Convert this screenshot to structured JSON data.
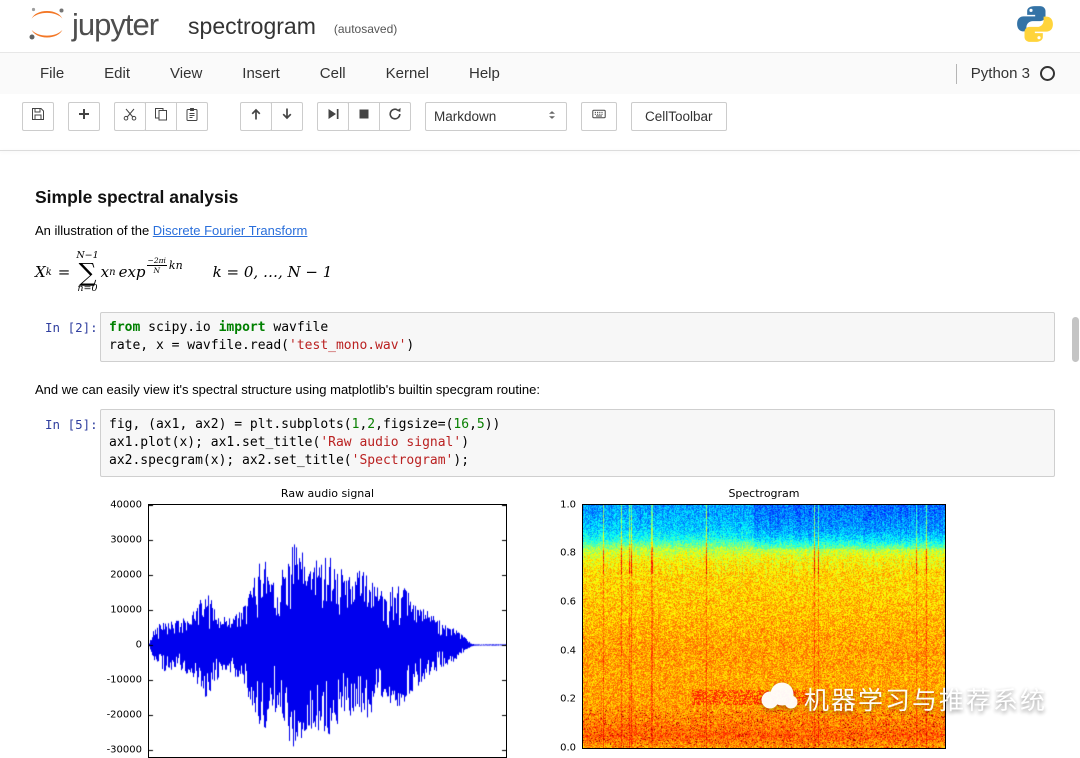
{
  "header": {
    "logo_text": "jupyter",
    "title": "spectrogram",
    "autosaved": "(autosaved)"
  },
  "menu": {
    "items": [
      "File",
      "Edit",
      "View",
      "Insert",
      "Cell",
      "Kernel",
      "Help"
    ],
    "kernel_name": "Python 3"
  },
  "toolbar": {
    "icons": [
      "save-icon",
      "add-cell-icon",
      "cut-icon",
      "copy-icon",
      "paste-icon",
      "arrow-up-icon",
      "arrow-down-icon",
      "run-icon",
      "stop-icon",
      "restart-icon",
      "keyboard-icon"
    ],
    "cell_type": "Markdown",
    "cell_toolbar_label": "CellToolbar"
  },
  "notebook": {
    "markdown_cell_1": {
      "heading": "Simple spectral analysis",
      "intro_text": "An illustration of the ",
      "link_text": "Discrete Fourier Transform",
      "formula": {
        "lhs_base": "X",
        "lhs_sub": "k",
        "equals": "=",
        "sum_upper": "N−1",
        "sum_symbol": "∑",
        "sum_lower": "n=0",
        "term_base": "x",
        "term_sub": "n",
        "func": "exp",
        "exp_numerator": "−2πi",
        "exp_denominator": "N",
        "exp_suffix": "kn",
        "condition": "k = 0, …, N − 1"
      }
    },
    "code_cell_1": {
      "prompt": "In [2]:",
      "lines": [
        [
          {
            "t": "kw",
            "v": "from"
          },
          {
            "t": "p",
            "v": " scipy.io "
          },
          {
            "t": "kw",
            "v": "import"
          },
          {
            "t": "p",
            "v": " wavfile"
          }
        ],
        [
          {
            "t": "p",
            "v": "rate, x = wavfile.read("
          },
          {
            "t": "s",
            "v": "'test_mono.wav'"
          },
          {
            "t": "p",
            "v": ")"
          }
        ]
      ]
    },
    "markdown_cell_2": {
      "text": "And we can easily view it's spectral structure using matplotlib's builtin specgram routine:"
    },
    "code_cell_2": {
      "prompt": "In [5]:",
      "lines": [
        [
          {
            "t": "p",
            "v": "fig, (ax1, ax2) = plt.subplots("
          },
          {
            "t": "n",
            "v": "1"
          },
          {
            "t": "p",
            "v": ","
          },
          {
            "t": "n",
            "v": "2"
          },
          {
            "t": "p",
            "v": ",figsize=("
          },
          {
            "t": "n",
            "v": "16"
          },
          {
            "t": "p",
            "v": ","
          },
          {
            "t": "n",
            "v": "5"
          },
          {
            "t": "p",
            "v": "))"
          }
        ],
        [
          {
            "t": "p",
            "v": "ax1.plot(x); ax1.set_title("
          },
          {
            "t": "s",
            "v": "'Raw audio signal'"
          },
          {
            "t": "p",
            "v": ")"
          }
        ],
        [
          {
            "t": "p",
            "v": "ax2.specgram(x); ax2.set_title("
          },
          {
            "t": "s",
            "v": "'Spectrogram'"
          },
          {
            "t": "p",
            "v": ");"
          }
        ]
      ]
    }
  },
  "chart_data": [
    {
      "type": "line",
      "title": "Raw audio signal",
      "ylim": [
        -32000,
        40000
      ],
      "yticks": [
        "40000",
        "30000",
        "20000",
        "10000",
        "0",
        "-10000",
        "-20000",
        "-30000"
      ],
      "line_color": "#0000ee",
      "amplitude_envelope": [
        [
          0,
          500
        ],
        [
          0.01,
          4000
        ],
        [
          0.04,
          8000
        ],
        [
          0.08,
          7000
        ],
        [
          0.12,
          9000
        ],
        [
          0.16,
          16000
        ],
        [
          0.2,
          8000
        ],
        [
          0.26,
          10000
        ],
        [
          0.32,
          27000
        ],
        [
          0.36,
          18000
        ],
        [
          0.4,
          30000
        ],
        [
          0.45,
          24000
        ],
        [
          0.5,
          27000
        ],
        [
          0.55,
          20000
        ],
        [
          0.6,
          22000
        ],
        [
          0.65,
          16000
        ],
        [
          0.7,
          18000
        ],
        [
          0.75,
          12000
        ],
        [
          0.8,
          8000
        ],
        [
          0.85,
          5000
        ],
        [
          0.88,
          2500
        ],
        [
          0.9,
          600
        ],
        [
          0.91,
          200
        ],
        [
          1,
          200
        ]
      ]
    },
    {
      "type": "heatmap",
      "title": "Spectrogram",
      "ylim": [
        0.0,
        1.0
      ],
      "yticks": [
        "1.0",
        "0.8",
        "0.6",
        "0.4",
        "0.2",
        "0.0"
      ],
      "colormap": "jet",
      "frequency_intensity_profile": [
        [
          0,
          0.72
        ],
        [
          0.05,
          0.78
        ],
        [
          0.1,
          0.75
        ],
        [
          0.15,
          0.73
        ],
        [
          0.2,
          0.72
        ],
        [
          0.3,
          0.71
        ],
        [
          0.4,
          0.72
        ],
        [
          0.5,
          0.7
        ],
        [
          0.6,
          0.68
        ],
        [
          0.72,
          0.66
        ],
        [
          0.78,
          0.62
        ],
        [
          0.82,
          0.55
        ],
        [
          0.86,
          0.4
        ],
        [
          0.9,
          0.33
        ],
        [
          0.95,
          0.3
        ],
        [
          1,
          0.28
        ]
      ]
    }
  ],
  "watermark": {
    "text": "机器学习与推荐系统"
  },
  "colors": {
    "jupyter_orange": "#f37726",
    "prompt_blue": "#303f9f",
    "keyword_green": "#008000",
    "string_red": "#ba2121"
  }
}
